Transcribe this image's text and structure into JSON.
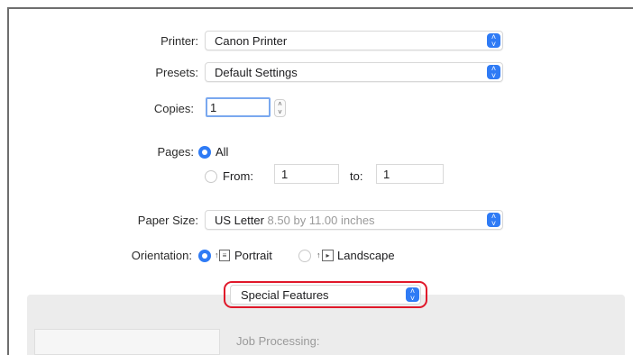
{
  "printer": {
    "label": "Printer:",
    "value": "Canon Printer"
  },
  "presets": {
    "label": "Presets:",
    "value": "Default Settings"
  },
  "copies": {
    "label": "Copies:",
    "value": "1"
  },
  "pages": {
    "label": "Pages:",
    "all_label": "All",
    "from_label": "From:",
    "from_value": "1",
    "to_label": "to:",
    "to_value": "1",
    "selected": "All"
  },
  "paper_size": {
    "label": "Paper Size:",
    "value": "US Letter",
    "detail": "8.50 by 11.00 inches"
  },
  "orientation": {
    "label": "Orientation:",
    "portrait_label": "Portrait",
    "landscape_label": "Landscape",
    "selected": "Portrait"
  },
  "section_select": {
    "value": "Special Features"
  },
  "section": {
    "job_processing_label": "Job Processing:"
  },
  "colors": {
    "accent": "#2f7bf5",
    "highlight": "#e0182a"
  }
}
